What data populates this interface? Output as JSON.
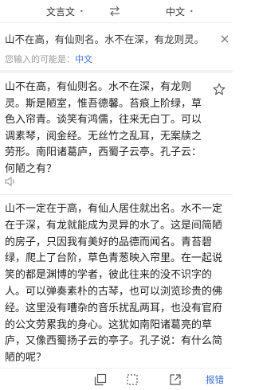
{
  "lang_bar": {
    "source_lang": "文言文",
    "target_lang": "中文",
    "caret": "•"
  },
  "input": {
    "text": "山不在高，有仙则名。水不在深，有龙则灵。"
  },
  "suggestion": {
    "label": "您输入的可能是：",
    "value": "中文"
  },
  "source_text": "山不在高，有仙则名。水不在深，有龙则灵。斯是陋室，惟吾德馨。苔痕上阶绿，草色入帘青。谈笑有鸿儒，往来无白丁。可以调素琴，阅金经。无丝竹之乱耳，无案牍之劳形。南阳诸葛庐，西蜀子云亭。孔子云：何陋之有？",
  "translation_text": "山不一定在于高，有仙人居住就出名。水不一定在于深，有龙就能成为灵异的水了。这是间简陋的房子，只因我有美好的品德而闻名。青苔碧绿，爬上了台阶，草色青葱映入帘里。在一起说笑的都是渊博的学者，彼此往来的没不识字的人。可以弹奏素朴的古琴，也可以浏览珍贵的佛经。这里没有嘈杂的音乐扰乱两耳，也没有官府的公文劳累我的身心。这犹如南阳诸葛亮的草庐，又像西蜀扬子云的亭子。孔子说：有什么简陋的呢？",
  "toolbar": {
    "report_label": "报错"
  },
  "icons": {
    "swap": "swap-arrows-icon",
    "close": "close-icon",
    "star": "star-outline-icon",
    "speaker": "speaker-icon",
    "copy": "copy-icon",
    "select": "select-text-icon",
    "share": "share-icon"
  },
  "colors": {
    "accent": "#3a6fd8",
    "hint": "#9a9a9a"
  }
}
